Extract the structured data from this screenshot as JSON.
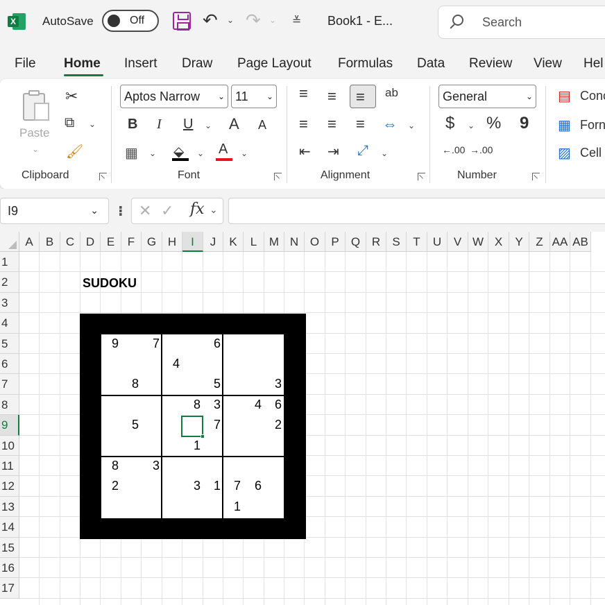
{
  "titlebar": {
    "autosave_label": "AutoSave",
    "autosave_state": "Off",
    "doc_title": "Book1  -  E...",
    "search_placeholder": "Search",
    "accent_color": "#107c41"
  },
  "tabs": [
    "File",
    "Home",
    "Insert",
    "Draw",
    "Page Layout",
    "Formulas",
    "Data",
    "Review",
    "View",
    "Hel"
  ],
  "active_tab": "Home",
  "ribbon": {
    "clipboard": {
      "paste_label": "Paste",
      "group_label": "Clipboard"
    },
    "font": {
      "font_name": "Aptos Narrow",
      "font_size": "11",
      "group_label": "Font",
      "bold": "B",
      "italic": "I",
      "underline": "U",
      "grow": "A",
      "shrink": "A",
      "font_color": "A"
    },
    "alignment": {
      "wrap": "ab",
      "group_label": "Alignment"
    },
    "number": {
      "format": "General",
      "group_label": "Number",
      "currency": "$",
      "percent": "%",
      "comma": "9",
      "inc_decimal": ".00",
      "dec_decimal": ".00"
    },
    "styles": {
      "conditional": "Conc",
      "format_table": "Forn",
      "cell_styles": "Cell"
    }
  },
  "formula_bar": {
    "name_box": "I9",
    "fx": "fx",
    "formula": ""
  },
  "columns": [
    "A",
    "B",
    "C",
    "D",
    "E",
    "F",
    "G",
    "H",
    "I",
    "J",
    "K",
    "L",
    "M",
    "N",
    "O",
    "P",
    "Q",
    "R",
    "S",
    "T",
    "U",
    "V",
    "W",
    "X",
    "Y",
    "Z",
    "AA",
    "AB"
  ],
  "rows": [
    "1",
    "2",
    "3",
    "4",
    "5",
    "6",
    "7",
    "8",
    "9",
    "10",
    "11",
    "12",
    "13",
    "14",
    "15",
    "16",
    "17"
  ],
  "selected_cell": {
    "column": "I",
    "row": "9"
  },
  "sheet": {
    "title": "SUDOKU",
    "givens": [
      {
        "row": 5,
        "col": "E",
        "value": "9"
      },
      {
        "row": 5,
        "col": "G",
        "value": "7"
      },
      {
        "row": 5,
        "col": "J",
        "value": "6"
      },
      {
        "row": 6,
        "col": "H",
        "value": "4"
      },
      {
        "row": 7,
        "col": "F",
        "value": "8"
      },
      {
        "row": 7,
        "col": "J",
        "value": "5"
      },
      {
        "row": 7,
        "col": "M",
        "value": "3"
      },
      {
        "row": 8,
        "col": "I",
        "value": "8"
      },
      {
        "row": 8,
        "col": "J",
        "value": "3"
      },
      {
        "row": 8,
        "col": "L",
        "value": "4"
      },
      {
        "row": 8,
        "col": "M",
        "value": "6"
      },
      {
        "row": 9,
        "col": "F",
        "value": "5"
      },
      {
        "row": 9,
        "col": "J",
        "value": "7"
      },
      {
        "row": 9,
        "col": "M",
        "value": "2"
      },
      {
        "row": 10,
        "col": "I",
        "value": "1"
      },
      {
        "row": 11,
        "col": "E",
        "value": "8"
      },
      {
        "row": 11,
        "col": "G",
        "value": "3"
      },
      {
        "row": 12,
        "col": "E",
        "value": "2"
      },
      {
        "row": 12,
        "col": "I",
        "value": "3"
      },
      {
        "row": 12,
        "col": "J",
        "value": "1"
      },
      {
        "row": 12,
        "col": "K",
        "value": "7"
      },
      {
        "row": 12,
        "col": "L",
        "value": "6"
      },
      {
        "row": 13,
        "col": "K",
        "value": "1"
      }
    ]
  }
}
